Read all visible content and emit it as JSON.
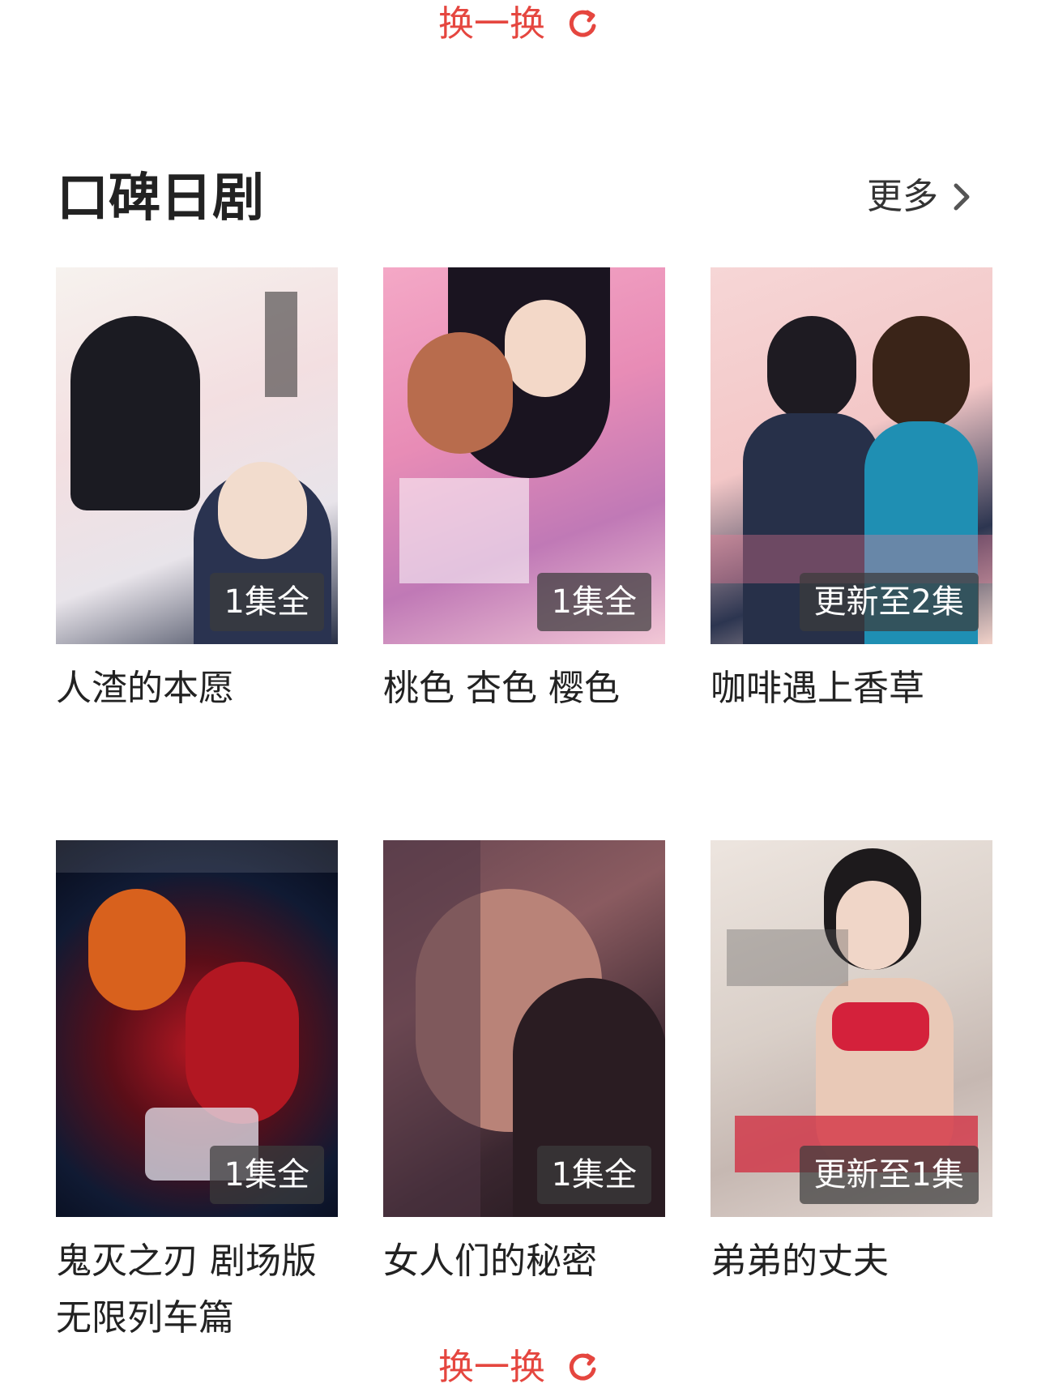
{
  "refresh": {
    "label": "换一换"
  },
  "section": {
    "title": "口碑日剧",
    "more_label": "更多"
  },
  "items": [
    {
      "title": "人渣的本愿",
      "badge": "1集全"
    },
    {
      "title": "桃色 杏色 樱色",
      "badge": "1集全"
    },
    {
      "title": "咖啡遇上香草",
      "badge": "更新至2集"
    },
    {
      "title": "鬼灭之刃 剧场版 无限列车篇",
      "badge": "1集全"
    },
    {
      "title": "女人们的秘密",
      "badge": "1集全"
    },
    {
      "title": "弟弟的丈夫",
      "badge": "更新至1集"
    }
  ],
  "colors": {
    "accent": "#e5463f",
    "badge_bg": "rgba(60,60,60,0.72)"
  },
  "icons": {
    "refresh": "refresh-icon",
    "more": "chevron-right-icon"
  }
}
